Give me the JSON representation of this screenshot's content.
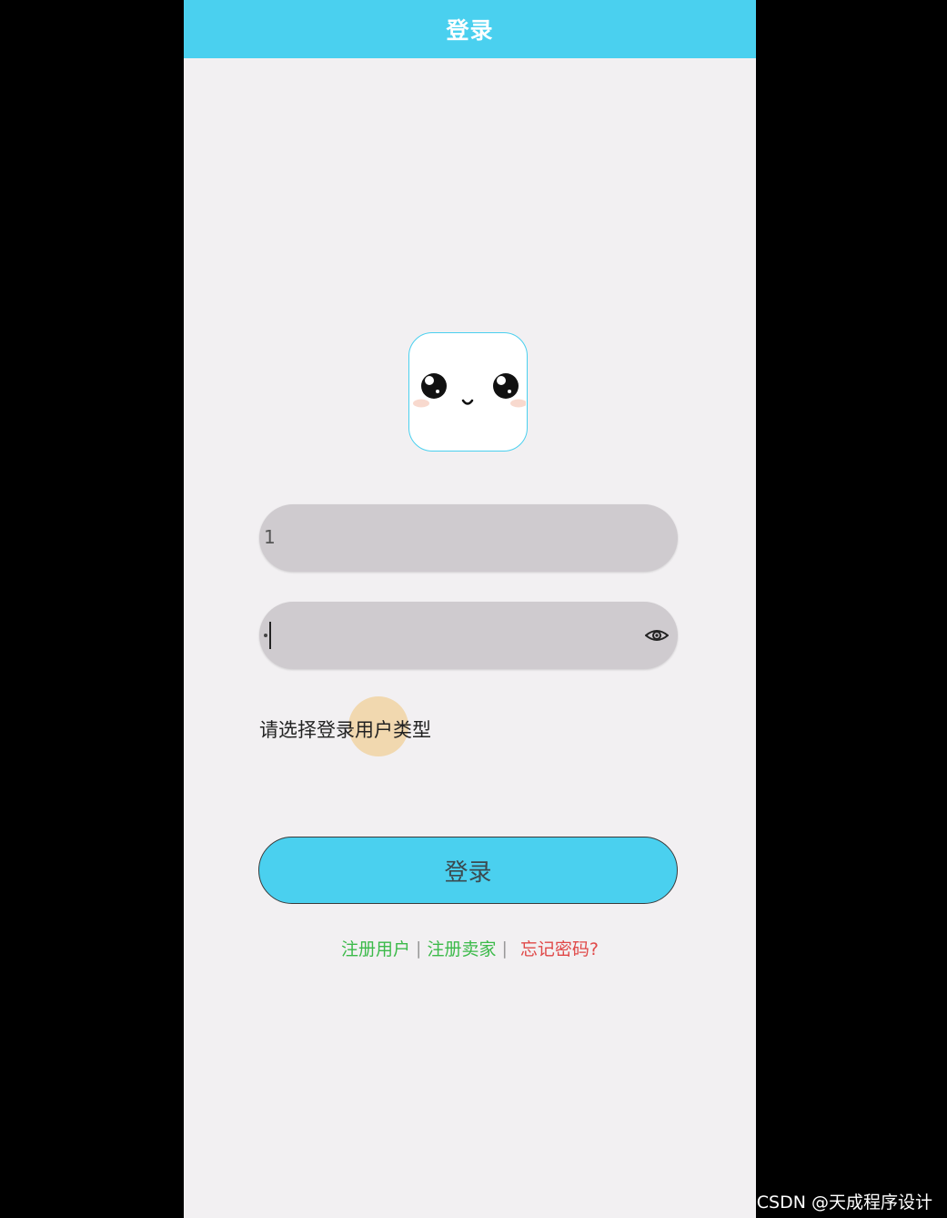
{
  "header": {
    "title": "登录",
    "background": "#4ad0ef"
  },
  "logo": {
    "icon": "cute-face-icon"
  },
  "form": {
    "username_value": "1",
    "password_masked": "•",
    "password_toggle_icon": "eye-icon",
    "user_type_prompt": "请选择登录用户类型"
  },
  "login_button": {
    "label": "登录",
    "color": "#4ad0ef"
  },
  "links": {
    "register_user": "注册用户",
    "separator": "|",
    "register_seller": "注册卖家",
    "forgot_password": "忘记密码?"
  },
  "colors": {
    "accent": "#4ad0ef",
    "link_green": "#3cba4a",
    "link_red": "#e04848",
    "page_bg": "#f2f0f2",
    "input_bg": "#cfcbcf"
  },
  "watermark": "CSDN @天成程序设计"
}
